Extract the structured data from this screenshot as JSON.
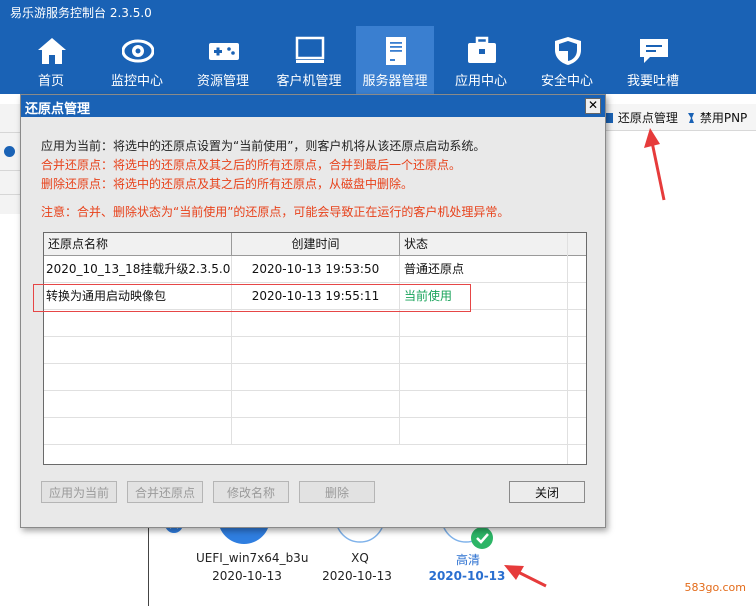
{
  "app": {
    "title": "易乐游服务控制台 2.3.5.0"
  },
  "nav": [
    {
      "label": "首页",
      "icon": "home-icon"
    },
    {
      "label": "监控中心",
      "icon": "eye-icon"
    },
    {
      "label": "资源管理",
      "icon": "gamepad-icon"
    },
    {
      "label": "客户机管理",
      "icon": "monitor-icon"
    },
    {
      "label": "服务器管理",
      "icon": "server-icon",
      "active": true
    },
    {
      "label": "应用中心",
      "icon": "toolbox-icon"
    },
    {
      "label": "安全中心",
      "icon": "shield-icon"
    },
    {
      "label": "我要吐槽",
      "icon": "chat-icon"
    }
  ],
  "bg_toolbar": {
    "restore_points": "还原点管理",
    "disable_pnp": "禁用PNP"
  },
  "dialog": {
    "title": "还原点管理",
    "close_glyph": "✕",
    "info_apply": "应用为当前：将选中的还原点设置为“当前使用”，则客户机将从该还原点启动系统。",
    "info_merge": "合并还原点：将选中的还原点及其之后的所有还原点，合并到最后一个还原点。",
    "info_delete": "删除还原点：将选中的还原点及其之后的所有还原点，从磁盘中删除。",
    "warning": "注意：合并、删除状态为“当前使用”的还原点，可能会导致正在运行的客户机处理异常。",
    "columns": [
      "还原点名称",
      "创建时间",
      "状态"
    ],
    "rows": [
      {
        "name": "2020_10_13_18挂载升级2.3.5.0",
        "time": "2020-10-13 19:53:50",
        "status": "普通还原点"
      },
      {
        "name": "转换为通用启动映像包",
        "time": "2020-10-13 19:55:11",
        "status": "当前使用"
      }
    ],
    "buttons": {
      "apply": "应用为当前",
      "merge": "合并还原点",
      "rename": "修改名称",
      "delete": "删除",
      "close": "关闭"
    }
  },
  "graph": {
    "nodes": [
      {
        "name": "UEFI_win7x64_b3u",
        "date": "2020-10-13"
      },
      {
        "name": "XQ",
        "date": "2020-10-13"
      },
      {
        "name": "高清",
        "date": "2020-10-13"
      }
    ]
  },
  "watermark": "583go.com",
  "colors": {
    "brand_blue": "#1a62b5",
    "warning_red": "#e8421b",
    "current_green": "#18a35a"
  }
}
